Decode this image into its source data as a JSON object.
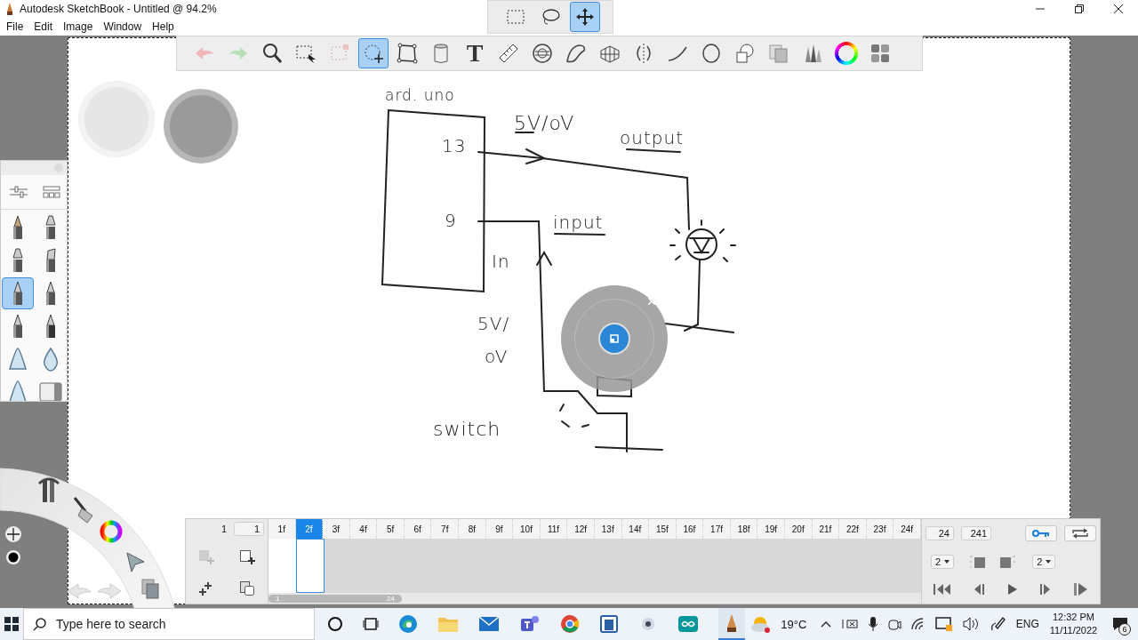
{
  "window": {
    "title": "Autodesk SketchBook - Untitled @ 94.2%"
  },
  "menu": [
    "File",
    "Edit",
    "Image",
    "Window",
    "Help"
  ],
  "selection_toolbar": {
    "tools": [
      {
        "kind": "rect-select",
        "selected": false
      },
      {
        "kind": "lasso",
        "selected": false
      },
      {
        "kind": "move",
        "selected": true
      }
    ]
  },
  "main_toolbar": {
    "tools": [
      {
        "kind": "undo",
        "selected": false,
        "disabled": true
      },
      {
        "kind": "redo",
        "selected": false,
        "disabled": true
      },
      {
        "kind": "zoom",
        "selected": false,
        "disabled": false
      },
      {
        "kind": "select",
        "selected": false,
        "disabled": false
      },
      {
        "kind": "crop",
        "selected": false,
        "disabled": true
      },
      {
        "kind": "transform",
        "selected": true,
        "disabled": false
      },
      {
        "kind": "distort",
        "selected": false,
        "disabled": false
      },
      {
        "kind": "fill",
        "selected": false,
        "disabled": false
      },
      {
        "kind": "text",
        "label": "T",
        "selected": false,
        "disabled": false
      },
      {
        "kind": "ruler",
        "selected": false,
        "disabled": false
      },
      {
        "kind": "ellipse-guide",
        "selected": false,
        "disabled": false
      },
      {
        "kind": "french-curve",
        "selected": false,
        "disabled": false
      },
      {
        "kind": "perspective",
        "selected": false,
        "disabled": false
      },
      {
        "kind": "symmetry",
        "selected": false,
        "disabled": false
      },
      {
        "kind": "line",
        "selected": false,
        "disabled": false
      },
      {
        "kind": "ellipse",
        "selected": false,
        "disabled": false
      },
      {
        "kind": "shapes",
        "selected": false,
        "disabled": false
      },
      {
        "kind": "layers",
        "selected": false,
        "disabled": false
      },
      {
        "kind": "brushes",
        "selected": false,
        "disabled": false
      },
      {
        "kind": "color-wheel",
        "selected": false,
        "disabled": false
      },
      {
        "kind": "swatches",
        "selected": false,
        "disabled": false
      }
    ]
  },
  "brush_palette": {
    "brushes": [
      {
        "kind": "pencil",
        "selected": false
      },
      {
        "kind": "tech-pen",
        "selected": false
      },
      {
        "kind": "marker",
        "selected": false
      },
      {
        "kind": "chisel",
        "selected": false
      },
      {
        "kind": "ballpoint",
        "selected": true
      },
      {
        "kind": "airbrush",
        "selected": false
      },
      {
        "kind": "fineliner",
        "selected": false
      },
      {
        "kind": "ink-pen",
        "selected": false
      },
      {
        "kind": "triangle",
        "selected": false
      },
      {
        "kind": "drop",
        "selected": false
      },
      {
        "kind": "triangle",
        "selected": false
      },
      {
        "kind": "eraser",
        "selected": false
      }
    ]
  },
  "sketch": {
    "labels": [
      {
        "text": "ard. uno"
      },
      {
        "text": "5V/oV"
      },
      {
        "text": "output"
      },
      {
        "text": "13"
      },
      {
        "text": "9"
      },
      {
        "text": "input"
      },
      {
        "text": "In"
      },
      {
        "text": "5V/"
      },
      {
        "text": "oV"
      },
      {
        "text": "switch"
      }
    ]
  },
  "timeline": {
    "current_frame": "1",
    "start_frame": "1",
    "frames": [
      {
        "label": "1f",
        "selected": false
      },
      {
        "label": "2f",
        "selected": true
      },
      {
        "label": "3f",
        "selected": false
      },
      {
        "label": "4f",
        "selected": false
      },
      {
        "label": "5f",
        "selected": false
      },
      {
        "label": "6f",
        "selected": false
      },
      {
        "label": "7f",
        "selected": false
      },
      {
        "label": "8f",
        "selected": false
      },
      {
        "label": "9f",
        "selected": false
      },
      {
        "label": "10f",
        "selected": false
      },
      {
        "label": "11f",
        "selected": false
      },
      {
        "label": "12f",
        "selected": false
      },
      {
        "label": "13f",
        "selected": false
      },
      {
        "label": "14f",
        "selected": false
      },
      {
        "label": "15f",
        "selected": false
      },
      {
        "label": "16f",
        "selected": false
      },
      {
        "label": "17f",
        "selected": false
      },
      {
        "label": "18f",
        "selected": false
      },
      {
        "label": "19f",
        "selected": false
      },
      {
        "label": "20f",
        "selected": false
      },
      {
        "label": "21f",
        "selected": false
      },
      {
        "label": "22f",
        "selected": false
      },
      {
        "label": "23f",
        "selected": false
      },
      {
        "label": "24f",
        "selected": false
      }
    ],
    "scroll_start": "1",
    "scroll_end": "24",
    "end_frame": "24",
    "total_frames": "241",
    "hold_before": "2",
    "hold_after": "2"
  },
  "taskbar": {
    "search_placeholder": "Type here to search",
    "temperature": "19°C",
    "language": "ENG",
    "time": "12:32 PM",
    "date": "11/11/2022",
    "notifications": "6"
  }
}
